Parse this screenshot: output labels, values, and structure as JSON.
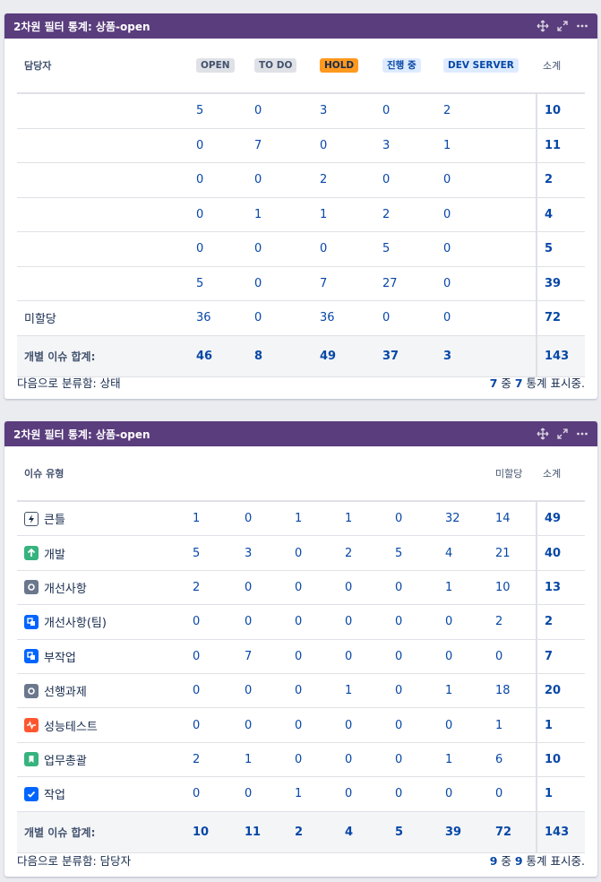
{
  "gadget1": {
    "title": "2차원 필터 통계: 상품-open",
    "row_header": "담당자",
    "columns": [
      {
        "label": "OPEN",
        "style": "gray"
      },
      {
        "label": "TO DO",
        "style": "gray"
      },
      {
        "label": "HOLD",
        "style": "orange"
      },
      {
        "label": "진행 중",
        "style": "blue"
      },
      {
        "label": "DEV SERVER",
        "style": "blue"
      }
    ],
    "subtotal_header": "소계",
    "rows": [
      {
        "label": "",
        "values": [
          "5",
          "0",
          "3",
          "0",
          "2"
        ],
        "total": "10"
      },
      {
        "label": "",
        "values": [
          "0",
          "7",
          "0",
          "3",
          "1"
        ],
        "total": "11"
      },
      {
        "label": "",
        "values": [
          "0",
          "0",
          "2",
          "0",
          "0"
        ],
        "total": "2"
      },
      {
        "label": "",
        "values": [
          "0",
          "1",
          "1",
          "2",
          "0"
        ],
        "total": "4"
      },
      {
        "label": "",
        "values": [
          "0",
          "0",
          "0",
          "5",
          "0"
        ],
        "total": "5"
      },
      {
        "label": "",
        "values": [
          "5",
          "0",
          "7",
          "27",
          "0"
        ],
        "total": "39"
      },
      {
        "label": "미할당",
        "values": [
          "36",
          "0",
          "36",
          "0",
          "0"
        ],
        "total": "72"
      }
    ],
    "footer": {
      "label": "개별 이슈 합계:",
      "values": [
        "46",
        "8",
        "49",
        "37",
        "3"
      ],
      "total": "143"
    },
    "group_by": "다음으로 분류함: 상태",
    "shown": {
      "a": "7",
      "mid": " 중 ",
      "b": "7",
      "suffix": " 통계 표시중."
    }
  },
  "gadget2": {
    "title": "2차원 필터 통계: 상품-open",
    "row_header": "이슈 유형",
    "columns": [
      "",
      "",
      "",
      "",
      "",
      "",
      "미할당"
    ],
    "subtotal_header": "소계",
    "rows": [
      {
        "label": "큰틀",
        "icon": "epic-icon",
        "color": "#ffffff",
        "values": [
          "1",
          "0",
          "1",
          "1",
          "0",
          "32",
          "14"
        ],
        "total": "49"
      },
      {
        "label": "개발",
        "icon": "improvement-arrow-icon",
        "color": "#36b37e",
        "values": [
          "5",
          "3",
          "0",
          "2",
          "5",
          "4",
          "21"
        ],
        "total": "40"
      },
      {
        "label": "개선사항",
        "icon": "task-circle-icon",
        "color": "#6b778c",
        "values": [
          "2",
          "0",
          "0",
          "0",
          "0",
          "1",
          "10"
        ],
        "total": "13"
      },
      {
        "label": "개선사항(팀)",
        "icon": "subtask-icon",
        "color": "#0065ff",
        "values": [
          "0",
          "0",
          "0",
          "0",
          "0",
          "0",
          "2"
        ],
        "total": "2"
      },
      {
        "label": "부작업",
        "icon": "subtask-icon",
        "color": "#0065ff",
        "values": [
          "0",
          "7",
          "0",
          "0",
          "0",
          "0",
          "0"
        ],
        "total": "7"
      },
      {
        "label": "선행과제",
        "icon": "task-circle-icon",
        "color": "#6b778c",
        "values": [
          "0",
          "0",
          "0",
          "1",
          "0",
          "1",
          "18"
        ],
        "total": "20"
      },
      {
        "label": "성능테스트",
        "icon": "pulse-icon",
        "color": "#ff5630",
        "values": [
          "0",
          "0",
          "0",
          "0",
          "0",
          "0",
          "1"
        ],
        "total": "1"
      },
      {
        "label": "업무총괄",
        "icon": "bookmark-icon",
        "color": "#36b37e",
        "values": [
          "2",
          "1",
          "0",
          "0",
          "0",
          "1",
          "6"
        ],
        "total": "10"
      },
      {
        "label": "작업",
        "icon": "checkbox-icon",
        "color": "#0065ff",
        "values": [
          "0",
          "0",
          "1",
          "0",
          "0",
          "0",
          "0"
        ],
        "total": "1"
      }
    ],
    "footer": {
      "label": "개별 이슈 합계:",
      "values": [
        "10",
        "11",
        "2",
        "4",
        "5",
        "39",
        "72"
      ],
      "total": "143"
    },
    "group_by": "다음으로 분류함: 담당자",
    "shown": {
      "a": "9",
      "mid": " 중 ",
      "b": "9",
      "suffix": " 통계 표시중."
    }
  }
}
